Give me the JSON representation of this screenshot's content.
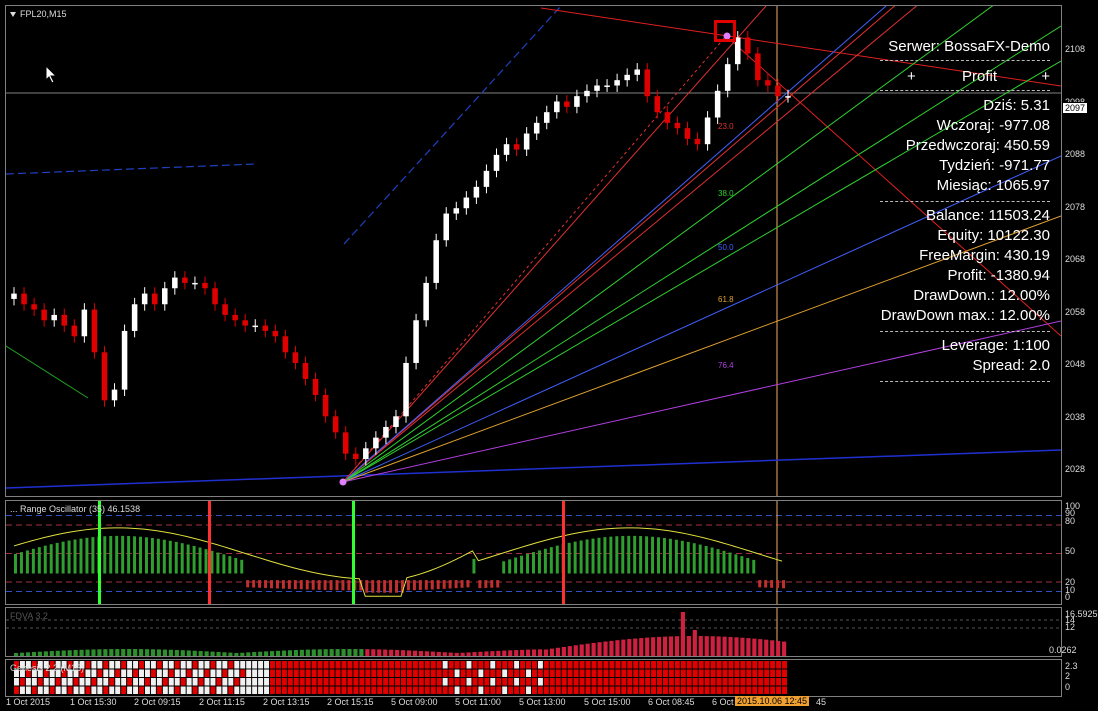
{
  "window": {
    "title": "FPL20,M15"
  },
  "chart_data": [
    {
      "type": "candlestick",
      "title": "FPL20,M15",
      "symbol": "FPL20",
      "timeframe": "M15",
      "y_ticks": [
        "2108",
        "2098",
        "2088",
        "2078",
        "2068",
        "2058",
        "2048",
        "2038",
        "2028"
      ],
      "ylim": [
        2023,
        2113
      ],
      "current_price": "2097",
      "closes": [
        2060,
        2058,
        2057,
        2055,
        2056,
        2054,
        2052,
        2057,
        2049,
        2040,
        2042,
        2053,
        2058,
        2060,
        2058,
        2061,
        2063,
        2062,
        2062,
        2061,
        2058,
        2056,
        2055,
        2054,
        2054,
        2053,
        2052,
        2049,
        2047,
        2044,
        2041,
        2037,
        2034,
        2030,
        2029,
        2031,
        2033,
        2035,
        2037,
        2047,
        2055,
        2062,
        2070,
        2075,
        2076,
        2078,
        2080,
        2083,
        2086,
        2088,
        2087,
        2090,
        2092,
        2094,
        2096,
        2095,
        2097,
        2098,
        2099,
        2099,
        2100,
        2101,
        2102,
        2097,
        2094,
        2092,
        2091,
        2089,
        2088,
        2093,
        2098,
        2103,
        2108,
        2105,
        2100,
        2099,
        2097,
        2097
      ],
      "fib_levels": [
        {
          "label": "23.0",
          "color": "#e03030"
        },
        {
          "label": "38.0",
          "color": "#30d030"
        },
        {
          "label": "50.0",
          "color": "#4060ff"
        },
        {
          "label": "61.8",
          "color": "#e0a030"
        },
        {
          "label": "76.4",
          "color": "#b040e0"
        }
      ]
    },
    {
      "type": "bar",
      "title": "... Range Oscillator (35) 46.1538",
      "y_ticks": [
        "100",
        "90",
        "80",
        "50",
        "20",
        "10",
        "0"
      ],
      "ylim": [
        0,
        100
      ]
    },
    {
      "type": "bar",
      "title": "FDVA 3.2",
      "y_ticks": [
        "16.5925",
        "14",
        "12",
        "0.0262"
      ]
    },
    {
      "type": "heatmap",
      "title": "Genesis 2.2 (M15)",
      "y_ticks": [
        "2.3",
        "2",
        "0"
      ]
    }
  ],
  "info_panel": {
    "server": "Serwer: BossaFX-Demo",
    "profit_header": "Profit",
    "plus_left": "+",
    "plus_right": "+",
    "today": "Dziś: 5.31",
    "yesterday": "Wczoraj: -977.08",
    "day_before": "Przedwczoraj: 450.59",
    "week": "Tydzień: -971.77",
    "month": "Miesiąc: 1065.97",
    "balance": "Balance: 11503.24",
    "equity": "Equity: 10122.30",
    "free_margin": "FreeMargin: 430.19",
    "profit": "Profit:  -1380.94",
    "drawdown": "DrawDown.:  12.00%",
    "drawdown_max": "DrawDown max.:  12.00%",
    "leverage": "Leverage: 1:100",
    "spread": "Spread: 2.0"
  },
  "time_axis": {
    "labels": [
      "1 Oct 2015",
      "1 Oct 15:30",
      "2 Oct 09:15",
      "2 Oct 11:15",
      "2 Oct 13:15",
      "2 Oct 15:15",
      "5 Oct 09:00",
      "5 Oct 11:00",
      "5 Oct 13:00",
      "5 Oct 15:00",
      "6 Oct 08:45",
      "6 Oct"
    ],
    "highlight": "2015.10.06 12:45",
    "tail": "45"
  },
  "colors": {
    "bull": "#ffffff",
    "bear": "#e00000",
    "grid": "#303030",
    "osc_line": "#e0e040",
    "osc_pos": "#2fa02f",
    "osc_neg": "#c03030",
    "vol": "#d02040"
  }
}
